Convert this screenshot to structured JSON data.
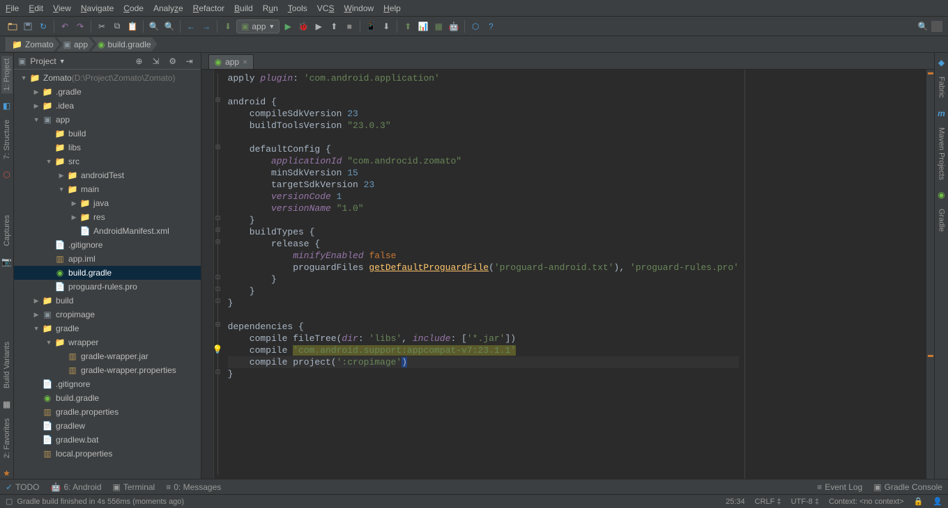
{
  "menu": [
    "File",
    "Edit",
    "View",
    "Navigate",
    "Code",
    "Analyze",
    "Refactor",
    "Build",
    "Run",
    "Tools",
    "VCS",
    "Window",
    "Help"
  ],
  "runConfig": {
    "label": "app"
  },
  "breadcrumb": [
    {
      "icon": "folder",
      "label": "Zomato"
    },
    {
      "icon": "module",
      "label": "app"
    },
    {
      "icon": "gradle",
      "label": "build.gradle"
    }
  ],
  "leftTabs": [
    {
      "label": "1: Project"
    },
    {
      "label": "7: Structure"
    },
    {
      "label": "Captures"
    },
    {
      "label": "Build Variants"
    },
    {
      "label": "2: Favorites"
    }
  ],
  "rightTabs": [
    {
      "label": "Fabric"
    },
    {
      "label": "Maven Projects"
    },
    {
      "label": "Gradle"
    }
  ],
  "projectPanel": {
    "mode": "Project",
    "root": {
      "name": "Zomato",
      "path": "(D:\\Project\\Zomato\\Zomato)"
    }
  },
  "tree": [
    {
      "d": 0,
      "tw": "▼",
      "ic": "folder",
      "cls": "folder",
      "txt": "Zomato",
      "extra": " (D:\\Project\\Zomato\\Zomato)"
    },
    {
      "d": 1,
      "tw": "▶",
      "ic": "folder",
      "cls": "folder",
      "txt": ".gradle"
    },
    {
      "d": 1,
      "tw": "▶",
      "ic": "folder",
      "cls": "folder",
      "txt": ".idea"
    },
    {
      "d": 1,
      "tw": "▼",
      "ic": "module",
      "cls": "mod-folder",
      "txt": "app"
    },
    {
      "d": 2,
      "tw": "",
      "ic": "folder",
      "cls": "folder",
      "txt": "build"
    },
    {
      "d": 2,
      "tw": "",
      "ic": "folder",
      "cls": "folder",
      "txt": "libs"
    },
    {
      "d": 2,
      "tw": "▼",
      "ic": "folder",
      "cls": "folder",
      "txt": "src"
    },
    {
      "d": 3,
      "tw": "▶",
      "ic": "folder",
      "cls": "folder-o",
      "txt": "androidTest"
    },
    {
      "d": 3,
      "tw": "▼",
      "ic": "folder",
      "cls": "folder-o",
      "txt": "main"
    },
    {
      "d": 4,
      "tw": "▶",
      "ic": "folder",
      "cls": "mod-folder",
      "txt": "java",
      "blue": true
    },
    {
      "d": 4,
      "tw": "▶",
      "ic": "folder",
      "cls": "folder",
      "txt": "res"
    },
    {
      "d": 4,
      "tw": "",
      "ic": "xml",
      "cls": "xml-ic",
      "txt": "AndroidManifest.xml"
    },
    {
      "d": 2,
      "tw": "",
      "ic": "file",
      "cls": "file-ic",
      "txt": ".gitignore"
    },
    {
      "d": 2,
      "tw": "",
      "ic": "ant",
      "cls": "ant-ic",
      "txt": "app.iml"
    },
    {
      "d": 2,
      "tw": "",
      "ic": "gradle",
      "cls": "gradle-ic",
      "txt": "build.gradle",
      "sel": true
    },
    {
      "d": 2,
      "tw": "",
      "ic": "file",
      "cls": "file-ic",
      "txt": "proguard-rules.pro"
    },
    {
      "d": 1,
      "tw": "▶",
      "ic": "folder",
      "cls": "folder",
      "txt": "build"
    },
    {
      "d": 1,
      "tw": "▶",
      "ic": "module",
      "cls": "mod-folder",
      "txt": "cropimage"
    },
    {
      "d": 1,
      "tw": "▼",
      "ic": "folder",
      "cls": "folder",
      "txt": "gradle"
    },
    {
      "d": 2,
      "tw": "▼",
      "ic": "folder",
      "cls": "folder",
      "txt": "wrapper"
    },
    {
      "d": 3,
      "tw": "",
      "ic": "ant",
      "cls": "ant-ic",
      "txt": "gradle-wrapper.jar"
    },
    {
      "d": 3,
      "tw": "",
      "ic": "ant",
      "cls": "ant-ic",
      "txt": "gradle-wrapper.properties"
    },
    {
      "d": 1,
      "tw": "",
      "ic": "file",
      "cls": "file-ic",
      "txt": ".gitignore"
    },
    {
      "d": 1,
      "tw": "",
      "ic": "gradle",
      "cls": "gradle-ic",
      "txt": "build.gradle"
    },
    {
      "d": 1,
      "tw": "",
      "ic": "ant",
      "cls": "ant-ic",
      "txt": "gradle.properties"
    },
    {
      "d": 1,
      "tw": "",
      "ic": "file",
      "cls": "file-ic",
      "txt": "gradlew"
    },
    {
      "d": 1,
      "tw": "",
      "ic": "file",
      "cls": "file-ic",
      "txt": "gradlew.bat"
    },
    {
      "d": 1,
      "tw": "",
      "ic": "ant",
      "cls": "ant-ic",
      "txt": "local.properties"
    }
  ],
  "editorTab": {
    "label": "app"
  },
  "code": {
    "l1a": "apply ",
    "l1b": "plugin",
    "l1c": ": ",
    "l1d": "'com.android.application'",
    "l2": "",
    "l3": "android {",
    "l4a": "    compileSdkVersion ",
    "l4b": "23",
    "l5a": "    buildToolsVersion ",
    "l5b": "\"23.0.3\"",
    "l6": "",
    "l7": "    defaultConfig {",
    "l8a": "        ",
    "l8b": "applicationId",
    "l8c": " ",
    "l8d": "\"com.androcid.zomato\"",
    "l9a": "        minSdkVersion ",
    "l9b": "15",
    "l10a": "        targetSdkVersion ",
    "l10b": "23",
    "l11a": "        ",
    "l11b": "versionCode",
    "l11c": " ",
    "l11d": "1",
    "l12a": "        ",
    "l12b": "versionName",
    "l12c": " ",
    "l12d": "\"1.0\"",
    "l13": "    }",
    "l14": "    buildTypes {",
    "l15": "        release {",
    "l16a": "            ",
    "l16b": "minifyEnabled",
    "l16c": " ",
    "l16d": "false",
    "l17a": "            proguardFiles ",
    "l17b": "getDefaultProguardFile",
    "l17c": "(",
    "l17d": "'proguard-android.txt'",
    "l17e": "), ",
    "l17f": "'proguard-rules.pro'",
    "l18": "        }",
    "l19": "    }",
    "l20": "}",
    "l21": "",
    "l22": "dependencies {",
    "l23a": "    compile fileTree(",
    "l23b": "dir",
    "l23c": ": ",
    "l23d": "'libs'",
    "l23e": ", ",
    "l23f": "include",
    "l23g": ": [",
    "l23h": "'*.jar'",
    "l23i": "])",
    "l24a": "    compile ",
    "l24b": "'com.android.support:appcompat-v7:23.1.1'",
    "l25a": "    compile project(",
    "l25b": "':cropimage'",
    "l25c": ")",
    "l26": "}"
  },
  "bottomBar": {
    "todo": "TODO",
    "android": "6: Android",
    "terminal": "Terminal",
    "messages": "0: Messages",
    "eventLog": "Event Log",
    "gradleConsole": "Gradle Console"
  },
  "status": {
    "msg": "Gradle build finished in 4s 556ms (moments ago)",
    "pos": "25:34",
    "crlf": "CRLF",
    "enc": "UTF-8",
    "ctx": "Context: <no context>"
  }
}
